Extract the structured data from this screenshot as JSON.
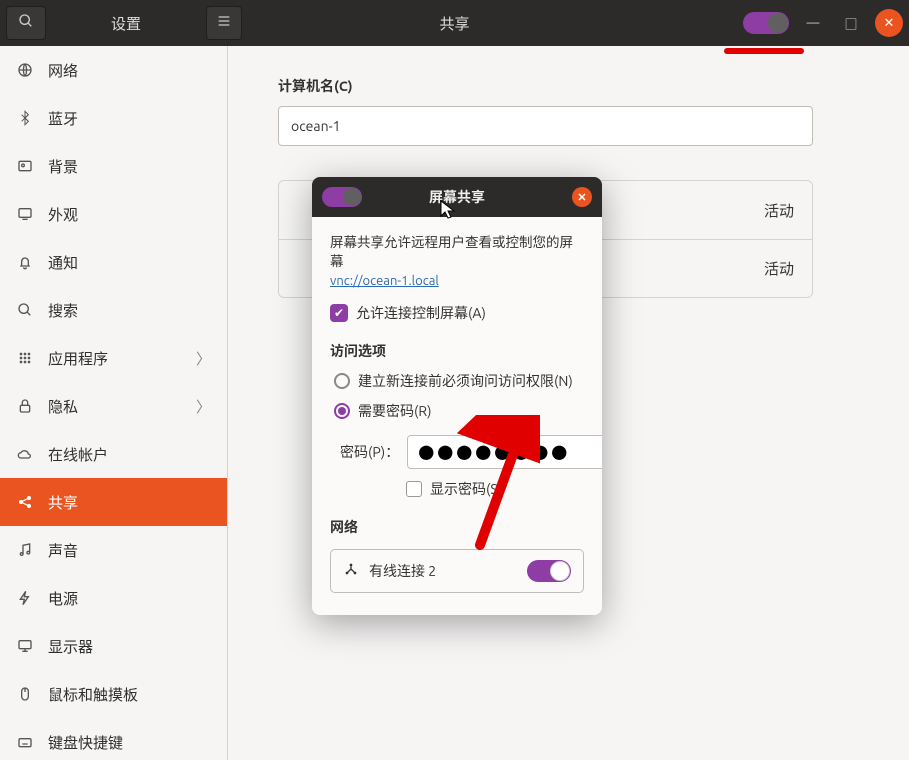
{
  "header": {
    "title_left": "设置",
    "title_center": "共享",
    "search_icon": "search-icon",
    "menu_icon": "hamburger-icon",
    "toggle_state": "on",
    "minimize": "—",
    "maximize": "□",
    "close": "✕"
  },
  "sidebar": {
    "items": [
      {
        "icon": "globe-icon",
        "label": "网络",
        "chevron": false
      },
      {
        "icon": "bluetooth-icon",
        "label": "蓝牙",
        "chevron": false
      },
      {
        "icon": "background-icon",
        "label": "背景",
        "chevron": false
      },
      {
        "icon": "appearance-icon",
        "label": "外观",
        "chevron": false
      },
      {
        "icon": "bell-icon",
        "label": "通知",
        "chevron": false
      },
      {
        "icon": "search-icon",
        "label": "搜索",
        "chevron": false
      },
      {
        "icon": "apps-icon",
        "label": "应用程序",
        "chevron": true
      },
      {
        "icon": "lock-icon",
        "label": "隐私",
        "chevron": true
      },
      {
        "icon": "cloud-icon",
        "label": "在线帐户",
        "chevron": false
      },
      {
        "icon": "share-icon",
        "label": "共享",
        "chevron": false,
        "active": true
      },
      {
        "icon": "music-icon",
        "label": "声音",
        "chevron": false
      },
      {
        "icon": "power-icon",
        "label": "电源",
        "chevron": false
      },
      {
        "icon": "display-icon",
        "label": "显示器",
        "chevron": false
      },
      {
        "icon": "mouse-icon",
        "label": "鼠标和触摸板",
        "chevron": false
      },
      {
        "icon": "keyboard-icon",
        "label": "键盘快捷键",
        "chevron": false
      }
    ]
  },
  "content": {
    "computer_name_label": "计算机名(C)",
    "computer_name_value": "ocean-1",
    "row1_label": "",
    "row1_status": "活动",
    "row2_label": "",
    "row2_status": "活动"
  },
  "dialog": {
    "title": "屏幕共享",
    "desc": "屏幕共享允许远程用户查看或控制您的屏幕",
    "link": "vnc://ocean-1.local",
    "allow_connection": "允许连接控制屏幕(A)",
    "access_options_title": "访问选项",
    "radio1": "建立新连接前必须询问访问权限(N)",
    "radio2": "需要密码(R)",
    "password_label": "密码(P)：",
    "password_value": "●●●●●●●●",
    "show_password": "显示密码(S)",
    "networks_title": "网络",
    "net_name": "有线连接 2",
    "close": "✕"
  }
}
